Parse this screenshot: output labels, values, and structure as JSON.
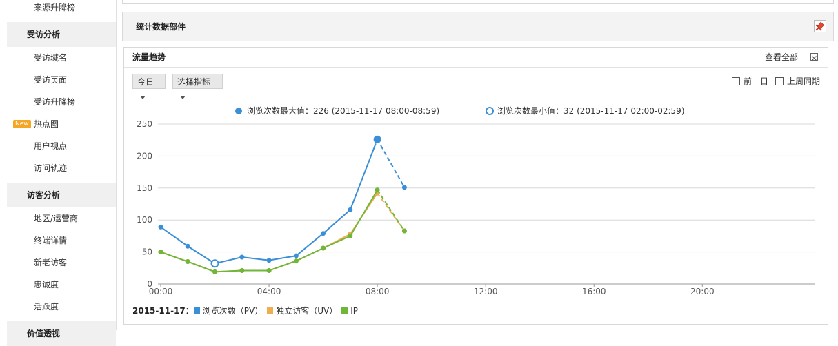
{
  "sidebar": {
    "items": [
      {
        "type": "item",
        "label": "来源升降榜"
      },
      {
        "type": "head",
        "label": "受访分析"
      },
      {
        "type": "item",
        "label": "受访域名"
      },
      {
        "type": "item",
        "label": "受访页面"
      },
      {
        "type": "item",
        "label": "受访升降榜"
      },
      {
        "type": "item",
        "label": "热点图",
        "badge": "New"
      },
      {
        "type": "item",
        "label": "用户视点"
      },
      {
        "type": "item",
        "label": "访问轨迹"
      },
      {
        "type": "head",
        "label": "访客分析"
      },
      {
        "type": "item",
        "label": "地区/运营商"
      },
      {
        "type": "item",
        "label": "终端详情"
      },
      {
        "type": "item",
        "label": "新老访客"
      },
      {
        "type": "item",
        "label": "忠诚度"
      },
      {
        "type": "item",
        "label": "活跃度"
      },
      {
        "type": "head",
        "label": "价值透视"
      }
    ]
  },
  "widgets_panel": {
    "title": "统计数据部件",
    "pin_icon": "pin-icon"
  },
  "traffic": {
    "title": "流量趋势",
    "view_all": "查看全部",
    "close_icon": "close-icon",
    "dropdown_day": "今日",
    "dropdown_metric": "选择指标",
    "checkbox_prev_day": "前一日",
    "checkbox_last_week": "上周同期"
  },
  "chart_data": {
    "type": "line",
    "max_annotation": "浏览次数最大值：226 (2015-11-17 08:00-08:59)",
    "min_annotation": "浏览次数最小值：32 (2015-11-17 02:00-02:59)",
    "legend_date": "2015-11-17：",
    "x": [
      0,
      1,
      2,
      3,
      4,
      5,
      6,
      7,
      8,
      9
    ],
    "x_ticks": [
      {
        "v": 0,
        "label": "00:00"
      },
      {
        "v": 4,
        "label": "04:00"
      },
      {
        "v": 8,
        "label": "08:00"
      },
      {
        "v": 12,
        "label": "12:00"
      },
      {
        "v": 16,
        "label": "16:00"
      },
      {
        "v": 20,
        "label": "20:00"
      }
    ],
    "xlim": [
      0,
      24
    ],
    "ylim": [
      0,
      250
    ],
    "y_ticks": [
      0,
      50,
      100,
      150,
      200,
      250
    ],
    "grid": true,
    "dashed_from_index": 8,
    "series": [
      {
        "name": "浏览次数（PV）",
        "color": "#3a8fd6",
        "values": [
          89,
          59,
          32,
          42,
          37,
          44,
          79,
          116,
          226,
          151
        ]
      },
      {
        "name": "独立访客（UV）",
        "color": "#f0ad4e",
        "values": [
          50,
          35,
          19,
          21,
          21,
          36,
          56,
          78,
          142,
          83
        ]
      },
      {
        "name": "IP",
        "color": "#6fb63a",
        "values": [
          50,
          35,
          19,
          21,
          21,
          36,
          56,
          75,
          147,
          83
        ]
      }
    ]
  }
}
